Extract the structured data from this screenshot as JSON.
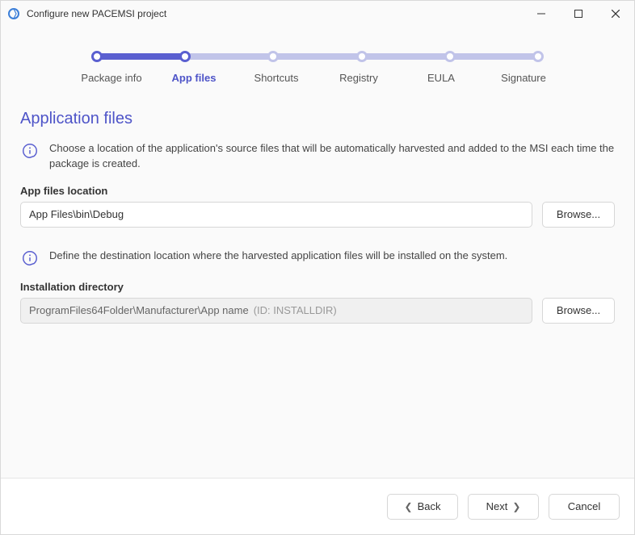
{
  "window": {
    "title": "Configure new PACEMSI project"
  },
  "stepper": {
    "steps": [
      {
        "label": "Package info"
      },
      {
        "label": "App files"
      },
      {
        "label": "Shortcuts"
      },
      {
        "label": "Registry"
      },
      {
        "label": "EULA"
      },
      {
        "label": "Signature"
      }
    ],
    "active_index": 1
  },
  "page": {
    "title": "Application files",
    "info1": "Choose a location of the application's source files that will be automatically harvested and added to the MSI each time the package is created.",
    "info2": "Define the destination location where the harvested application files will be installed on the system."
  },
  "fields": {
    "app_files_location": {
      "label": "App files location",
      "value": "App Files\\bin\\Debug",
      "browse": "Browse..."
    },
    "install_dir": {
      "label": "Installation directory",
      "value": "ProgramFiles64Folder\\Manufacturer\\App name",
      "hint": "(ID: INSTALLDIR)",
      "browse": "Browse..."
    }
  },
  "footer": {
    "back": "Back",
    "next": "Next",
    "cancel": "Cancel"
  }
}
